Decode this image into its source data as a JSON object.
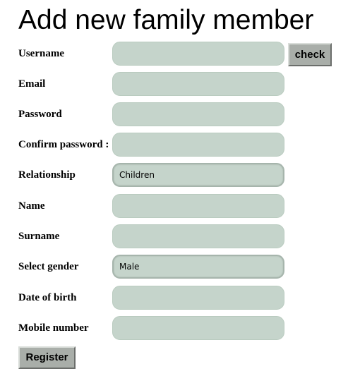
{
  "page": {
    "title": "Add new family member"
  },
  "form": {
    "fields": [
      {
        "label": "Username",
        "value": ""
      },
      {
        "label": "Email",
        "value": ""
      },
      {
        "label": "Password",
        "value": ""
      },
      {
        "label": "Confirm password :",
        "value": ""
      },
      {
        "label": "Relationship",
        "value": "Children"
      },
      {
        "label": "Name",
        "value": ""
      },
      {
        "label": "Surname",
        "value": ""
      },
      {
        "label": "Select gender",
        "value": "Male"
      },
      {
        "label": "Date of birth",
        "value": ""
      },
      {
        "label": "Mobile number",
        "value": ""
      }
    ],
    "check_label": "check",
    "register_label": "Register"
  },
  "colors": {
    "field_background": "#c5d4cb",
    "button_background": "#a9aea9"
  }
}
